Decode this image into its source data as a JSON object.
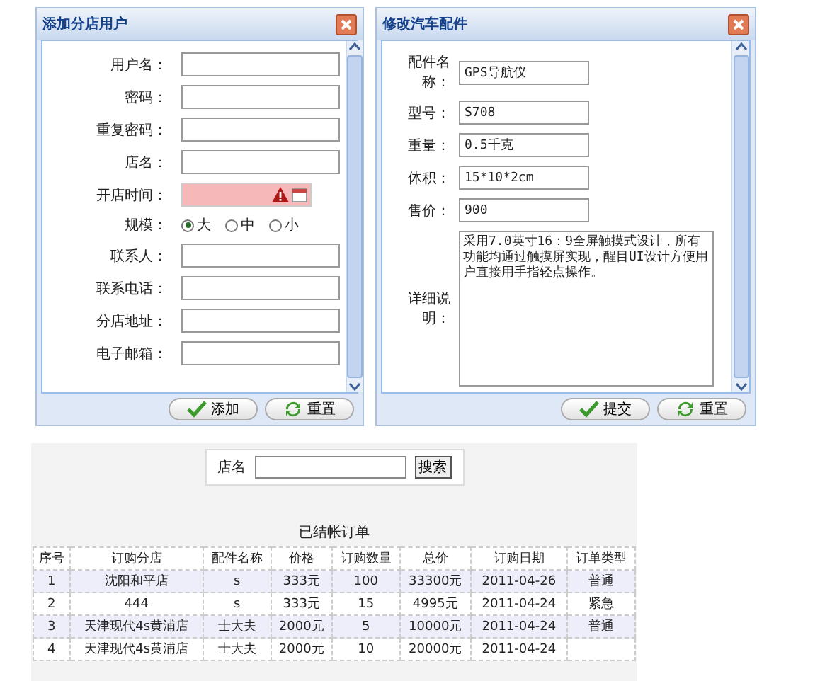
{
  "dialogs": [
    {
      "title": "添加分店用户",
      "fields": [
        {
          "kind": "text",
          "label": "用户名："
        },
        {
          "kind": "text",
          "label": "密码："
        },
        {
          "kind": "text",
          "label": "重复密码："
        },
        {
          "kind": "text",
          "label": "店名："
        },
        {
          "kind": "date",
          "label": "开店时间：",
          "invalid": true
        },
        {
          "kind": "radio",
          "label": "规模：",
          "options": [
            {
              "label": "大",
              "selected": true
            },
            {
              "label": "中",
              "selected": false
            },
            {
              "label": "小",
              "selected": false
            }
          ]
        },
        {
          "kind": "text",
          "label": "联系人："
        },
        {
          "kind": "text",
          "label": "联系电话："
        },
        {
          "kind": "text",
          "label": "分店地址："
        },
        {
          "kind": "text",
          "label": "电子邮箱："
        }
      ],
      "buttons": [
        "添加",
        "重置"
      ]
    },
    {
      "title": "修改汽车配件",
      "fields": [
        {
          "kind": "text",
          "label": "配件名称：",
          "value": "GPS导航仪"
        },
        {
          "kind": "text",
          "label": "型号：",
          "value": "S708"
        },
        {
          "kind": "text",
          "label": "重量：",
          "value": "0.5千克"
        },
        {
          "kind": "text",
          "label": "体积：",
          "value": "15*10*2cm"
        },
        {
          "kind": "text",
          "label": "售价：",
          "value": "900"
        },
        {
          "kind": "textarea",
          "label": "详细说明：",
          "value": "采用7.0英寸16：9全屏触摸式设计，所有功能均通过触摸屏实现，醒目UI设计方便用户直接用手指轻点操作。"
        }
      ],
      "buttons": [
        "提交",
        "重置"
      ]
    }
  ],
  "search": {
    "label": "店名",
    "button": "搜索"
  },
  "table": {
    "title": "已结帐订单",
    "columns": [
      "序号",
      "订购分店",
      "配件名称",
      "价格",
      "订购数量",
      "总价",
      "订购日期",
      "订单类型"
    ],
    "rows": [
      [
        "1",
        "沈阳和平店",
        "s",
        "333元",
        "100",
        "33300元",
        "2011-04-26",
        "普通"
      ],
      [
        "2",
        "444",
        "s",
        "333元",
        "15",
        "4995元",
        "2011-04-24",
        "紧急"
      ],
      [
        "3",
        "天津现代4s黄浦店",
        "士大夫",
        "2000元",
        "5",
        "10000元",
        "2011-04-24",
        "普通"
      ],
      [
        "4",
        "天津现代4s黄浦店",
        "士大夫",
        "2000元",
        "10",
        "20000元",
        "2011-04-24"
      ]
    ]
  }
}
